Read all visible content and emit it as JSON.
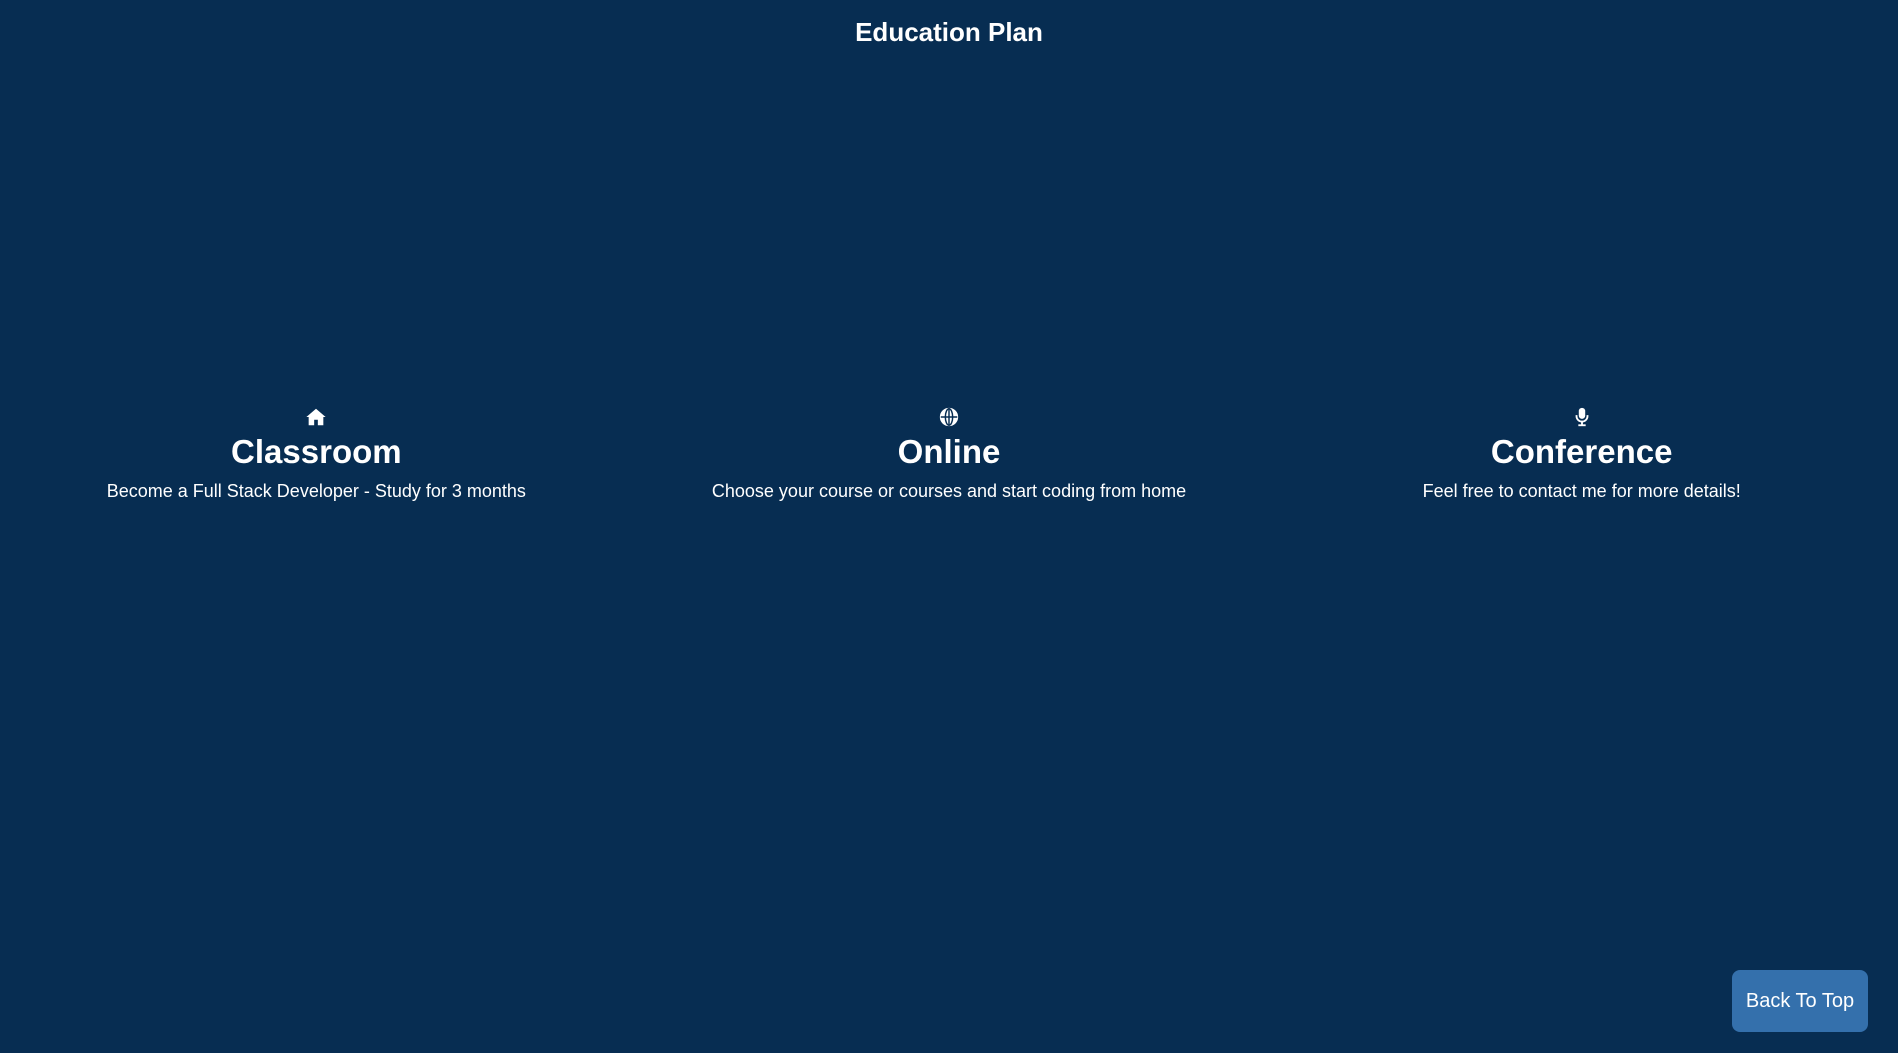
{
  "page": {
    "title": "Education Plan",
    "background_color": "#072d52",
    "text_color": "#ffffff"
  },
  "plans": [
    {
      "icon": "home-icon",
      "title": "Classroom",
      "description": "Become a Full Stack Developer - Study for 3 months"
    },
    {
      "icon": "globe-icon",
      "title": "Online",
      "description": "Choose your course or courses and start coding from home"
    },
    {
      "icon": "microphone-icon",
      "title": "Conference",
      "description": "Feel free to contact me for more details!"
    }
  ],
  "back_to_top": {
    "label": "Back To Top",
    "color": "#3470ac"
  }
}
